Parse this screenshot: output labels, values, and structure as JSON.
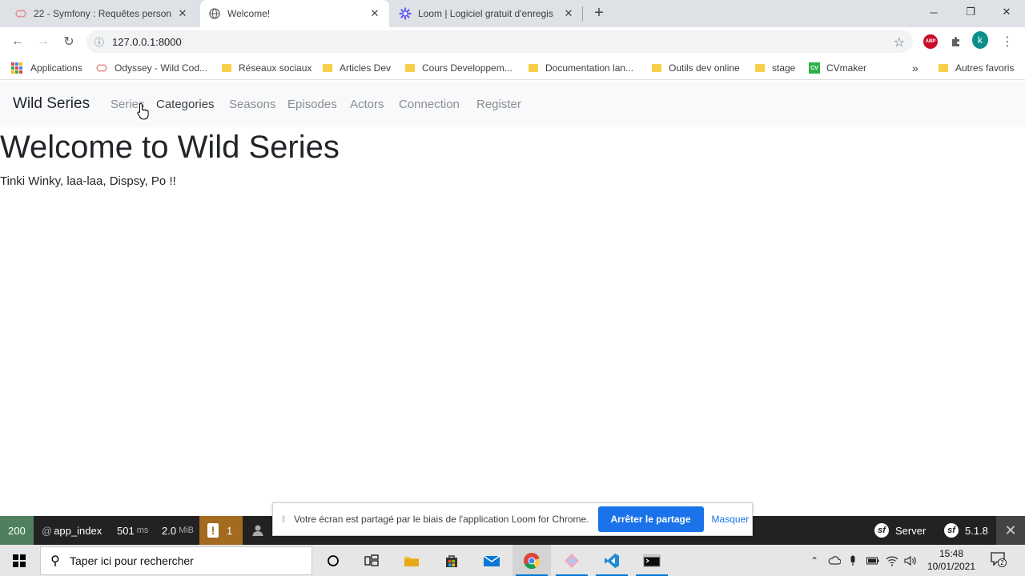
{
  "browser": {
    "tabs": [
      {
        "title": "22 - Symfony : Requêtes personn",
        "active": false
      },
      {
        "title": "Welcome!",
        "active": true
      },
      {
        "title": "Loom | Logiciel gratuit d'enregis",
        "active": false
      }
    ],
    "url": "127.0.0.1:8000",
    "profile_initial": "k",
    "abp_label": "ABP",
    "bookmarks": [
      "Applications",
      "Odyssey - Wild Cod...",
      "Réseaux sociaux",
      "Articles Dev",
      "Cours Developpem...",
      "Documentation lan...",
      "Outils dev online",
      "stage",
      "CVmaker"
    ],
    "bookmarks_overflow": "»",
    "other_bookmarks": "Autres favoris",
    "cv_badge": "CV"
  },
  "site": {
    "brand": "Wild Series",
    "nav": [
      "Series",
      "Categories",
      "Seasons",
      "Episodes",
      "Actors",
      "Connection",
      "Register"
    ],
    "heading": "Welcome to Wild Series",
    "lead": "Tinki Winky, laa-laa, Dispsy, Po !!"
  },
  "symfony_toolbar": {
    "status": "200",
    "route": "app_index",
    "time_value": "501",
    "time_unit": "ms",
    "memory_value": "2.0",
    "memory_unit": "MiB",
    "warnings": "1",
    "server_label": "Server",
    "version": "5.1.8",
    "sf_glyph": "sf"
  },
  "loom_banner": {
    "message": "Votre écran est partagé par le biais de l'application Loom for Chrome.",
    "stop_button": "Arrêter le partage",
    "hide_link": "Masquer"
  },
  "taskbar": {
    "search_placeholder": "Taper ici pour rechercher",
    "time": "15:48",
    "date": "10/01/2021",
    "notification_count": "2"
  },
  "colors": {
    "symfony_ok": "#4f805d",
    "symfony_warning": "#a46a1f",
    "loom_blue": "#1a73e8",
    "navbar_bg": "#f8f9fa"
  }
}
